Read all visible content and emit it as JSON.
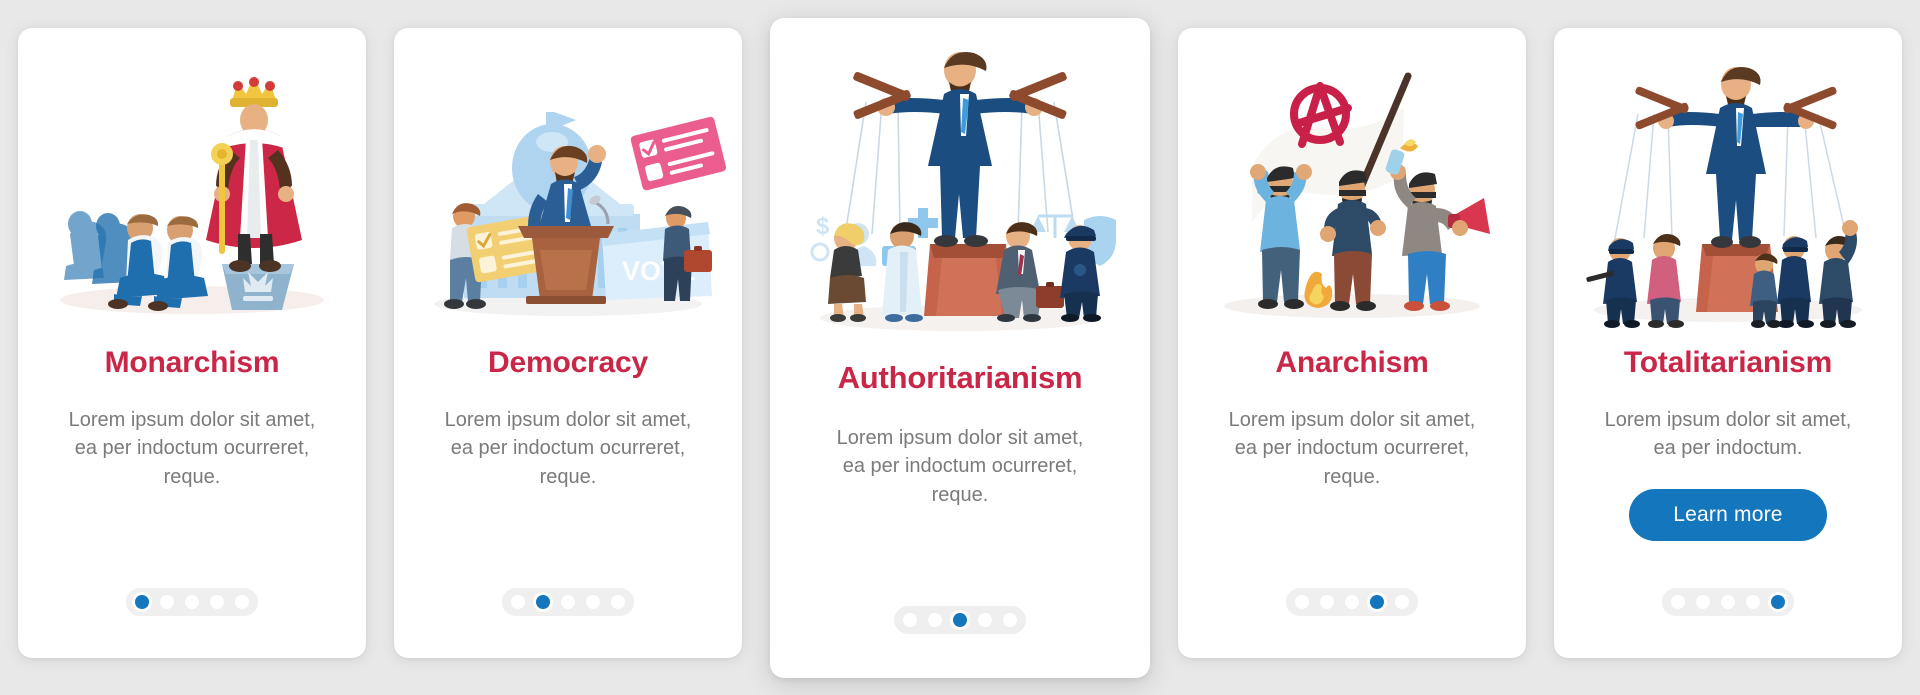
{
  "background_color": "#e8e8e8",
  "card_color": "#ffffff",
  "accent": {
    "title_color": "#ca2647",
    "button_color": "#1476bd",
    "dot_active_color": "#1476bd",
    "dot_inactive_color": "#ffffff",
    "pager_track_color": "#efefef",
    "body_text_color": "#7b7b7b"
  },
  "pagination": {
    "total": 5
  },
  "screens": [
    {
      "id": "monarchism",
      "title": "Monarchism",
      "body": "Lorem ipsum dolor sit amet, ea per indoctum ocurreret, reque.",
      "illustration": "king-on-pedestal-with-kneeling-subjects",
      "illustration_labels": [],
      "active_dot": 1,
      "featured": false,
      "has_button": false,
      "button_label": ""
    },
    {
      "id": "democracy",
      "title": "Democracy",
      "body": "Lorem ipsum dolor sit amet, ea per indoctum ocurreret, reque.",
      "illustration": "politician-at-podium-with-ballots-and-capitol",
      "illustration_labels": [
        "VOTE"
      ],
      "active_dot": 2,
      "featured": false,
      "has_button": false,
      "button_label": ""
    },
    {
      "id": "authoritarianism",
      "title": "Authoritarianism",
      "body": "Lorem ipsum dolor sit amet, ea per indoctum ocurreret, reque.",
      "illustration": "puppeteer-on-pedestal-controlling-citizens",
      "illustration_labels": [
        "$"
      ],
      "active_dot": 3,
      "featured": true,
      "has_button": false,
      "button_label": ""
    },
    {
      "id": "anarchism",
      "title": "Anarchism",
      "body": "Lorem ipsum dolor sit amet, ea per indoctum ocurreret, reque.",
      "illustration": "masked-protesters-with-anarchy-flag-molotov-megaphone",
      "illustration_labels": [],
      "active_dot": 4,
      "featured": false,
      "has_button": false,
      "button_label": ""
    },
    {
      "id": "totalitarianism",
      "title": "Totalitarianism",
      "body": "Lorem ipsum dolor sit amet, ea per indoctum.",
      "illustration": "puppeteer-leader-controlling-crowd-of-people",
      "illustration_labels": [],
      "active_dot": 5,
      "featured": false,
      "has_button": true,
      "button_label": "Learn more"
    }
  ]
}
